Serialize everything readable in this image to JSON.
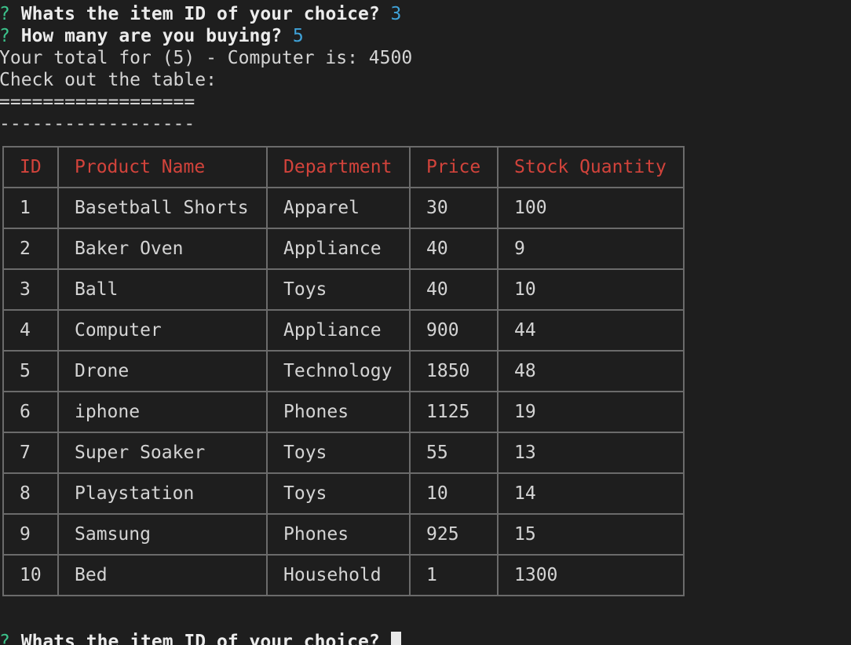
{
  "terminal": {
    "prompt_marker": "?",
    "q1": {
      "text": "Whats the item ID of your choice?",
      "answer": "3"
    },
    "q2": {
      "text": "How many are you buying?",
      "answer": "5"
    },
    "total_line": "Your total for (5) - Computer is: 4500",
    "checkout_line": "Check out the table:",
    "rule_double": "==================",
    "rule_single": "------------------",
    "next_prompt": "Whats the item ID of your choice?"
  },
  "table": {
    "headers": [
      "ID",
      "Product Name",
      "Department",
      "Price",
      "Stock Quantity"
    ],
    "rows": [
      [
        "1",
        "Basetball Shorts",
        "Apparel",
        "30",
        "100"
      ],
      [
        "2",
        "Baker Oven",
        "Appliance",
        "40",
        "9"
      ],
      [
        "3",
        "Ball",
        "Toys",
        "40",
        "10"
      ],
      [
        "4",
        "Computer",
        "Appliance",
        "900",
        "44"
      ],
      [
        "5",
        "Drone",
        "Technology",
        "1850",
        "48"
      ],
      [
        "6",
        "iphone",
        "Phones",
        "1125",
        "19"
      ],
      [
        "7",
        "Super Soaker",
        "Toys",
        "55",
        "13"
      ],
      [
        "8",
        "Playstation",
        "Toys",
        "10",
        "14"
      ],
      [
        "9",
        "Samsung",
        "Phones",
        "925",
        "15"
      ],
      [
        "10",
        "Bed",
        "Household",
        "1",
        "1300"
      ]
    ]
  },
  "colors": {
    "background": "#1e1e1e",
    "prompt_marker": "#3cc48c",
    "answer": "#3fa2d8",
    "header_text": "#d2433b",
    "border": "#6b6b6b"
  }
}
